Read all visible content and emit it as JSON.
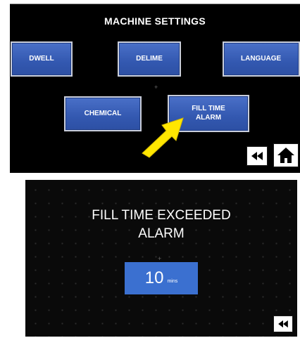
{
  "settings_screen": {
    "title": "MACHINE SETTINGS",
    "buttons": {
      "dwell": "DWELL",
      "delime": "DELIME",
      "language": "LANGUAGE",
      "chemical": "CHEMICAL",
      "fill_time_alarm": "FILL TIME\nALARM"
    },
    "back_icon": "rewind-icon",
    "home_icon": "home-icon",
    "pointer_icon": "arrow-pointer-icon"
  },
  "alarm_screen": {
    "title": "FILL TIME EXCEEDED\nALARM",
    "value": "10",
    "unit": "mins",
    "back_icon": "rewind-icon"
  },
  "colors": {
    "button_blue": "#3358b0",
    "value_blue": "#3b70d0",
    "arrow_yellow": "#ffe600",
    "screen_bg": "#000000"
  }
}
